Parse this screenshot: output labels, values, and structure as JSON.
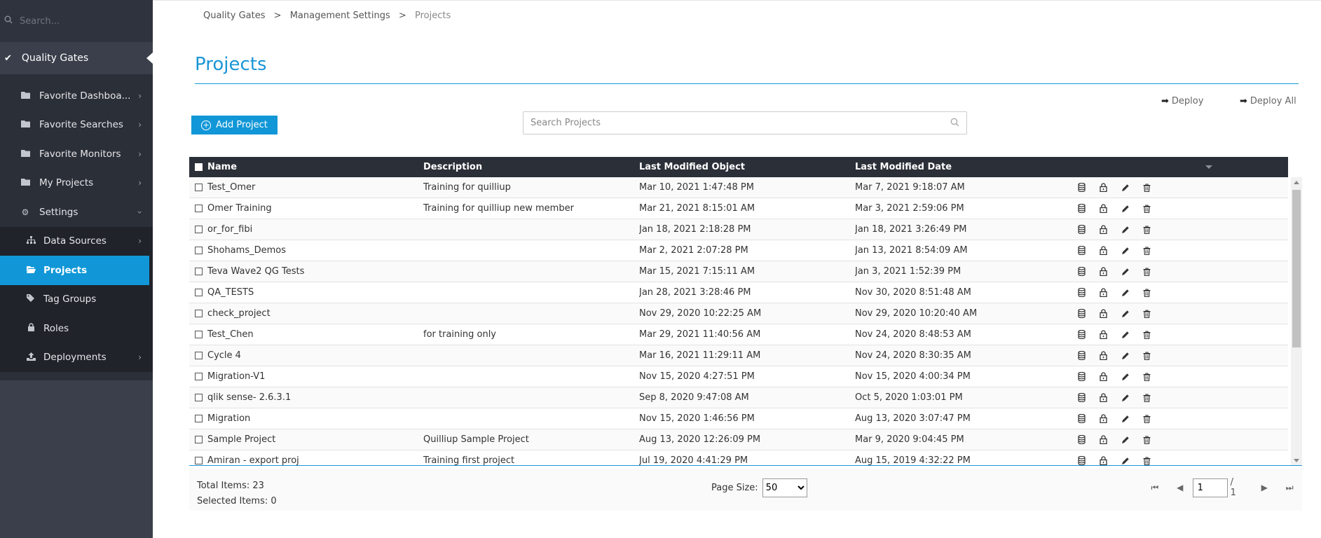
{
  "sidebar": {
    "search_placeholder": "Search...",
    "top_item": "Quality Gates",
    "items": [
      {
        "label": "Favorite Dashboa...",
        "icon": "folder-icon"
      },
      {
        "label": "Favorite Searches",
        "icon": "folder-icon"
      },
      {
        "label": "Favorite Monitors",
        "icon": "folder-icon"
      },
      {
        "label": "My Projects",
        "icon": "folder-icon"
      },
      {
        "label": "Settings",
        "icon": "gear-icon"
      }
    ],
    "settings_sub": [
      {
        "label": "Data Sources",
        "icon": "sitemap-icon"
      },
      {
        "label": "Projects",
        "icon": "folder-open-icon"
      },
      {
        "label": "Tag Groups",
        "icon": "tags-icon"
      },
      {
        "label": "Roles",
        "icon": "lock-icon"
      },
      {
        "label": "Deployments",
        "icon": "upload-icon"
      }
    ],
    "accent": "#1197d7"
  },
  "breadcrumb": [
    "Quality Gates",
    "Management Settings",
    "Projects"
  ],
  "page_title": "Projects",
  "toolbar": {
    "deploy_label": "Deploy",
    "deploy_all_label": "Deploy All",
    "add_label": "Add Project",
    "search_placeholder": "Search Projects"
  },
  "table": {
    "headers": [
      "Name",
      "Description",
      "Last Modified Object",
      "Last Modified Date"
    ],
    "rows": [
      {
        "name": "Test_Omer",
        "desc": "Training for quilliup",
        "obj": "Mar 10, 2021 1:47:48 PM",
        "date": "Mar 7, 2021 9:18:07 AM"
      },
      {
        "name": "Omer Training",
        "desc": "Training for quilliup new member",
        "obj": "Mar 21, 2021 8:15:01 AM",
        "date": "Mar 3, 2021 2:59:06 PM"
      },
      {
        "name": "or_for_fibi",
        "desc": "",
        "obj": "Jan 18, 2021 2:18:28 PM",
        "date": "Jan 18, 2021 3:26:49 PM"
      },
      {
        "name": "Shohams_Demos",
        "desc": "",
        "obj": "Mar 2, 2021 2:07:28 PM",
        "date": "Jan 13, 2021 8:54:09 AM"
      },
      {
        "name": "Teva Wave2 QG Tests",
        "desc": "",
        "obj": "Mar 15, 2021 7:15:11 AM",
        "date": "Jan 3, 2021 1:52:39 PM"
      },
      {
        "name": "QA_TESTS",
        "desc": "",
        "obj": "Jan 28, 2021 3:28:46 PM",
        "date": "Nov 30, 2020 8:51:48 AM"
      },
      {
        "name": "check_project",
        "desc": "",
        "obj": "Nov 29, 2020 10:22:25 AM",
        "date": "Nov 29, 2020 10:20:40 AM"
      },
      {
        "name": "Test_Chen",
        "desc": "for training only",
        "obj": "Mar 29, 2021 11:40:56 AM",
        "date": "Nov 24, 2020 8:48:53 AM"
      },
      {
        "name": "Cycle 4",
        "desc": "",
        "obj": "Mar 16, 2021 11:29:11 AM",
        "date": "Nov 24, 2020 8:30:35 AM"
      },
      {
        "name": "Migration-V1",
        "desc": "",
        "obj": "Nov 15, 2020 4:27:51 PM",
        "date": "Nov 15, 2020 4:00:34 PM"
      },
      {
        "name": "qlik sense- 2.6.3.1",
        "desc": "",
        "obj": "Sep 8, 2020 9:47:08 AM",
        "date": "Oct 5, 2020 1:03:01 PM"
      },
      {
        "name": "Migration",
        "desc": "",
        "obj": "Nov 15, 2020 1:46:56 PM",
        "date": "Aug 13, 2020 3:07:47 PM"
      },
      {
        "name": "Sample Project",
        "desc": "Quilliup Sample Project",
        "obj": "Aug 13, 2020 12:26:09 PM",
        "date": "Mar 9, 2020 9:04:45 PM"
      },
      {
        "name": "Amiran - export proj",
        "desc": "Training first project",
        "obj": "Jul 19, 2020 4:41:29 PM",
        "date": "Aug 15, 2019 4:32:22 PM"
      }
    ]
  },
  "footer": {
    "total_items": "Total Items: 23",
    "selected_items": "Selected Items: 0",
    "page_size_label": "Page Size:",
    "page_size_value": "50",
    "page_current": "1",
    "page_of": "/ 1"
  }
}
